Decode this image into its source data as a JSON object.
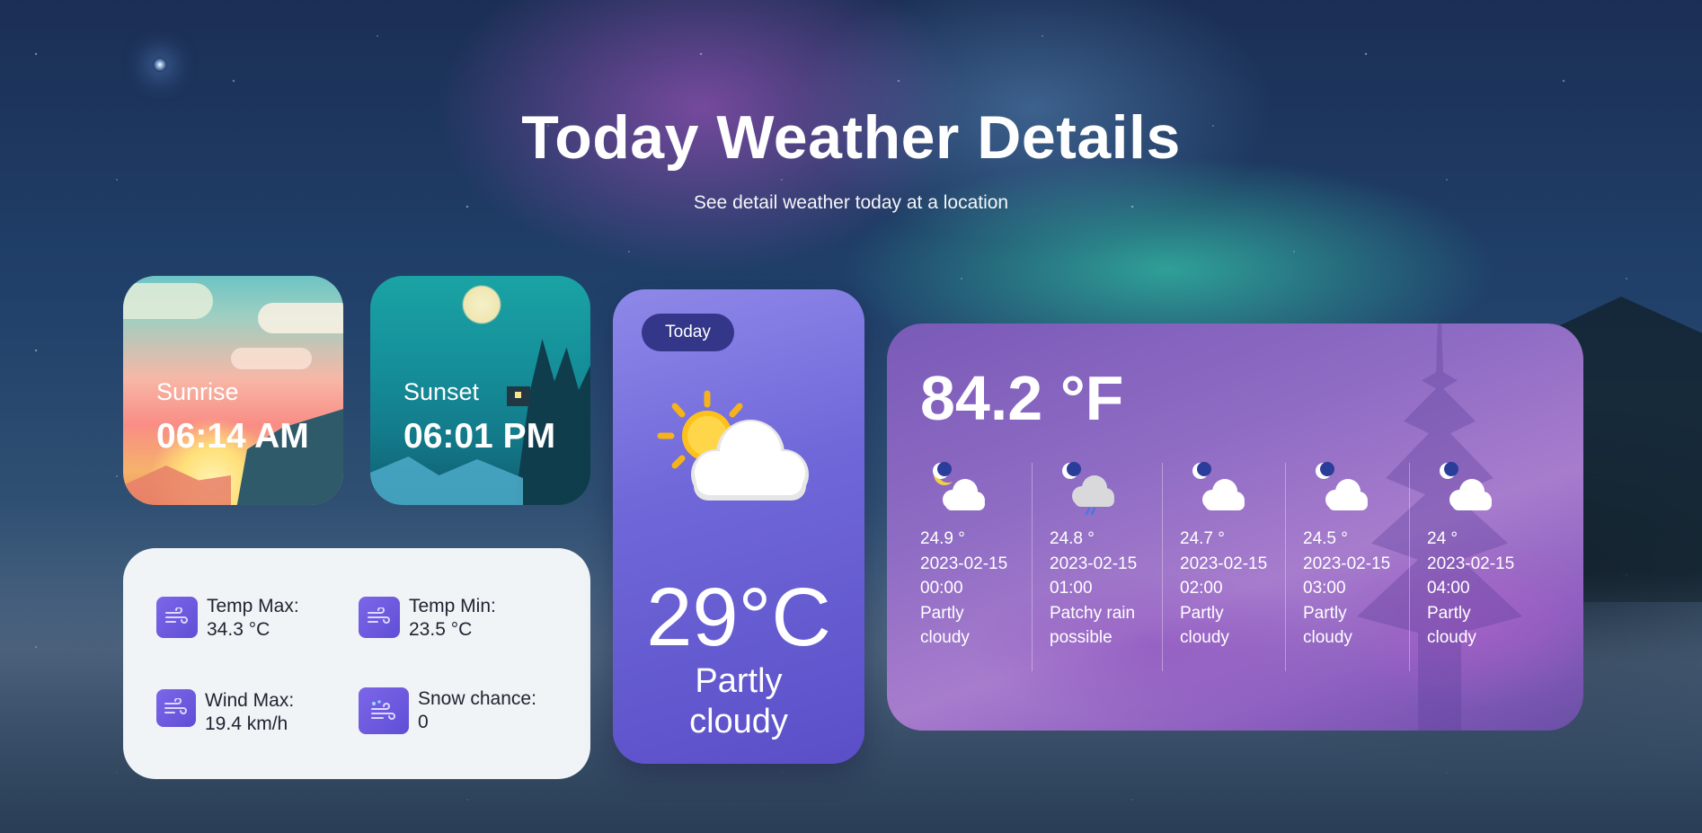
{
  "header": {
    "title": "Today Weather Details",
    "subtitle": "See detail weather today at a location"
  },
  "sunrise": {
    "label": "Sunrise",
    "time": "06:14 AM"
  },
  "sunset": {
    "label": "Sunset",
    "time": "06:01 PM"
  },
  "stats": {
    "temp_max": {
      "label": "Temp Max:",
      "value": "34.3 °C",
      "icon": "wind-icon"
    },
    "temp_min": {
      "label": "Temp Min:",
      "value": "23.5 °C",
      "icon": "wind-icon"
    },
    "wind_max": {
      "label": "Wind Max:",
      "value": "19.4 km/h",
      "icon": "wind-icon"
    },
    "snow_chance": {
      "label": "Snow chance:",
      "value": "0",
      "icon": "snow-wind-icon"
    }
  },
  "today": {
    "pill": "Today",
    "temperature": "29°C",
    "condition": "Partly cloudy",
    "icon": "sun-behind-cloud-icon"
  },
  "forecast": {
    "temperature": "84.2 °F",
    "hours": [
      {
        "temp": "24.9 °",
        "datetime": "2023-02-15 00:00",
        "condition": "Partly cloudy",
        "icon": "moon-cloud-icon"
      },
      {
        "temp": "24.8 °",
        "datetime": "2023-02-15 01:00",
        "condition": "Patchy rain possible",
        "icon": "moon-rain-cloud-icon"
      },
      {
        "temp": "24.7 °",
        "datetime": "2023-02-15 02:00",
        "condition": "Partly cloudy",
        "icon": "moon-cloud-icon"
      },
      {
        "temp": "24.5 °",
        "datetime": "2023-02-15 03:00",
        "condition": "Partly cloudy",
        "icon": "moon-cloud-icon"
      },
      {
        "temp": "24 °",
        "datetime": "2023-02-15 04:00",
        "condition": "Partly cloudy",
        "icon": "moon-cloud-icon"
      }
    ]
  },
  "colors": {
    "today_card": "#7068d9",
    "today_pill": "#34368a",
    "stat_icon": "#6a59df",
    "stats_panel": "#f0f4f7"
  }
}
